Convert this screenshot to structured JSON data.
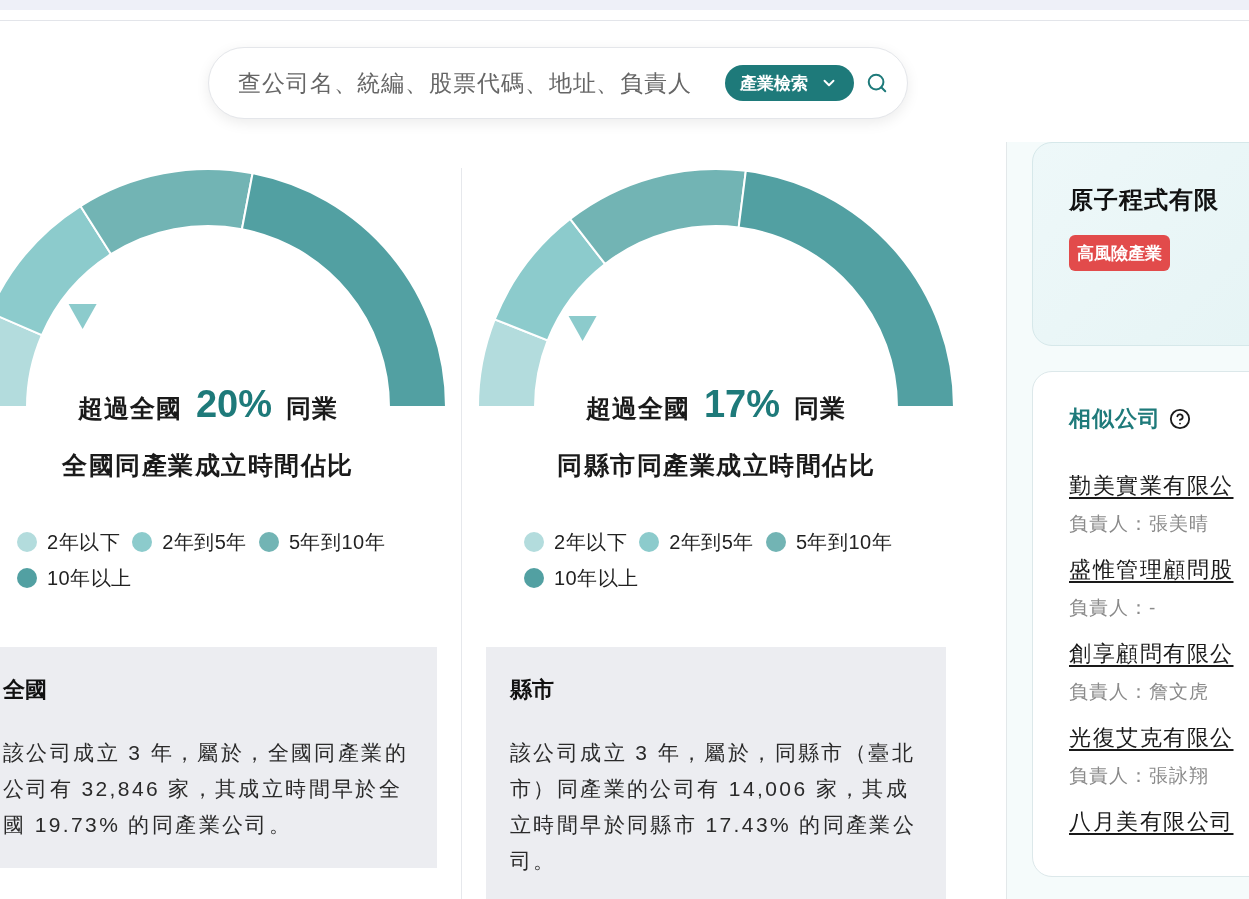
{
  "search": {
    "placeholder": "查公司名、統編、股票代碼、地址、負責人",
    "filter_button": "產業檢索"
  },
  "panels": [
    {
      "headline_prefix": "超過全國",
      "headline_value": "20%",
      "headline_suffix": "同業",
      "level": 0.2,
      "title": "全國同產業成立時間佔比",
      "chart_data": {
        "type": "donut",
        "values": [
          13,
          19,
          24,
          44
        ]
      },
      "legend": [
        {
          "label": "2年以下",
          "color": "#b3dcdd"
        },
        {
          "label": "2年到5年",
          "color": "#8ccbcc"
        },
        {
          "label": "5年到10年",
          "color": "#72b4b4"
        },
        {
          "label": "10年以上",
          "color": "#52a0a2"
        }
      ],
      "info": {
        "title": "全國",
        "text": "該公司成立 3 年，屬於，全國同產業的公司有 32,846 家，其成立時間早於全國 19.73% 的同產業公司。"
      }
    },
    {
      "headline_prefix": "超過全國",
      "headline_value": "17%",
      "headline_suffix": "同業",
      "level": 0.17,
      "title": "同縣市同產業成立時間佔比",
      "chart_data": {
        "type": "donut",
        "values": [
          12,
          17,
          25,
          46
        ]
      },
      "legend": [
        {
          "label": "2年以下",
          "color": "#b3dcdd"
        },
        {
          "label": "2年到5年",
          "color": "#8ccbcc"
        },
        {
          "label": "5年到10年",
          "color": "#72b4b4"
        },
        {
          "label": "10年以上",
          "color": "#52a0a2"
        }
      ],
      "info": {
        "title": "縣市",
        "text": "該公司成立 3 年，屬於，同縣市（臺北市）同產業的公司有 14,006 家，其成立時間早於同縣市 17.43% 的同產業公司。"
      }
    }
  ],
  "company_card": {
    "name": "原子程式有限",
    "badge": "高風險產業"
  },
  "similar_companies": {
    "title": "相似公司",
    "items": [
      {
        "name": "勤美實業有限公",
        "owner": "負責人：張美晴"
      },
      {
        "name": "盛惟管理顧問股",
        "owner": "負責人：-"
      },
      {
        "name": "創享顧問有限公",
        "owner": "負責人：詹文虎"
      },
      {
        "name": "光復艾克有限公",
        "owner": "負責人：張詠翔"
      },
      {
        "name": "八月美有限公司"
      }
    ]
  }
}
